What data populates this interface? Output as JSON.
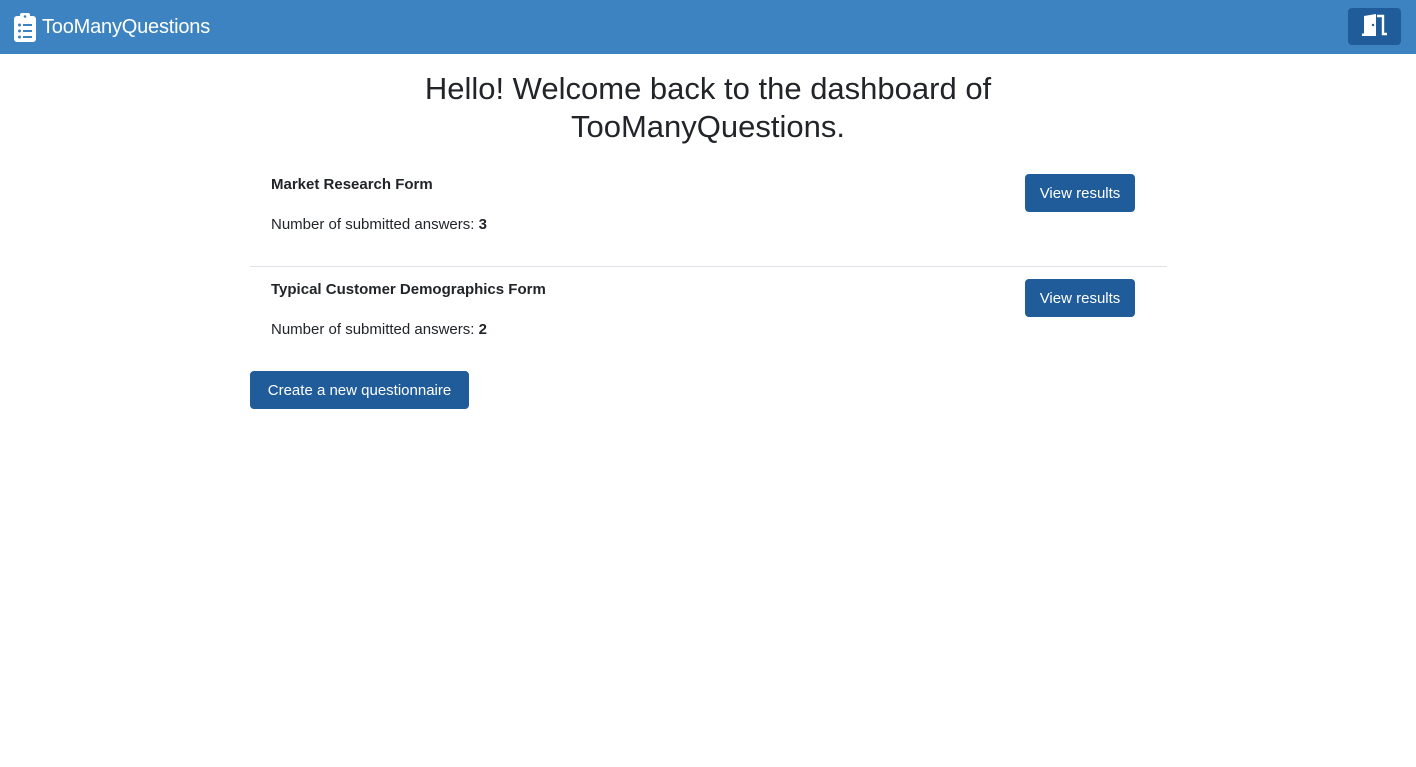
{
  "header": {
    "brand_icon": "clipboard-list-icon",
    "brand_name": "TooManyQuestions",
    "logout_icon": "door-open-icon"
  },
  "main": {
    "welcome_title": "Hello! Welcome back to the dashboard of TooManyQuestions.",
    "forms": [
      {
        "name": "Market Research Form",
        "answers_label": "Number of submitted answers: ",
        "answers_count": "3",
        "action_label": "View results"
      },
      {
        "name": "Typical Customer Demographics Form",
        "answers_label": "Number of submitted answers: ",
        "answers_count": "2",
        "action_label": "View results"
      }
    ],
    "create_label": "Create a new questionnaire"
  },
  "colors": {
    "navbar": "#3d83c1",
    "primary_button": "#1f5c99",
    "text": "#212529",
    "divider": "#dee2e6"
  }
}
